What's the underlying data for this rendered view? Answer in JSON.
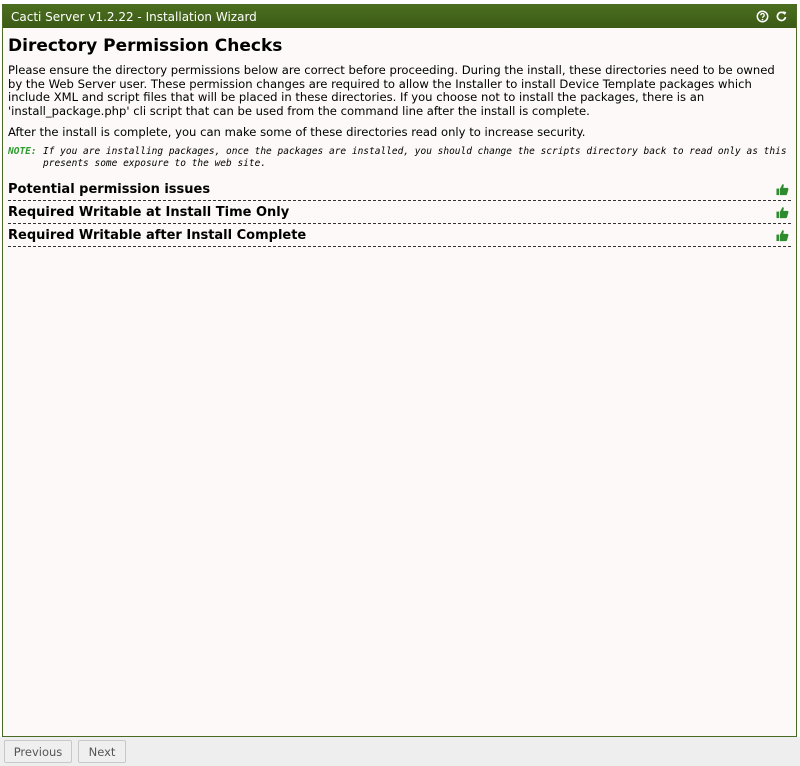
{
  "window": {
    "title": "Cacti Server v1.2.22 - Installation Wizard",
    "help_icon": "help-circle-icon",
    "refresh_icon": "refresh-icon"
  },
  "page": {
    "heading": "Directory Permission Checks",
    "description": "Please ensure the directory permissions below are correct before proceeding. During the install, these directories need to be owned by the Web Server user. These permission changes are required to allow the Installer to install Device Template packages which include XML and script files that will be placed in these directories. If you choose not to install the packages, there is an 'install_package.php' cli script that can be used from the command line after the install is complete.",
    "after_install": "After the install is complete, you can make some of these directories read only to increase security.",
    "note_label": "NOTE:",
    "note_text": "If you are installing packages, once the packages are installed, you should change the scripts directory back to read only as this presents some exposure to the web site."
  },
  "sections": [
    {
      "title": "Potential permission issues",
      "status_icon": "thumbs-up-icon"
    },
    {
      "title": "Required Writable at Install Time Only",
      "status_icon": "thumbs-up-icon"
    },
    {
      "title": "Required Writable after Install Complete",
      "status_icon": "thumbs-up-icon"
    }
  ],
  "footer": {
    "previous_label": "Previous",
    "next_label": "Next"
  },
  "colors": {
    "titlebar": "#3f5f18",
    "ok_icon": "#2e8b2e",
    "note_label": "#2e9c2e"
  }
}
